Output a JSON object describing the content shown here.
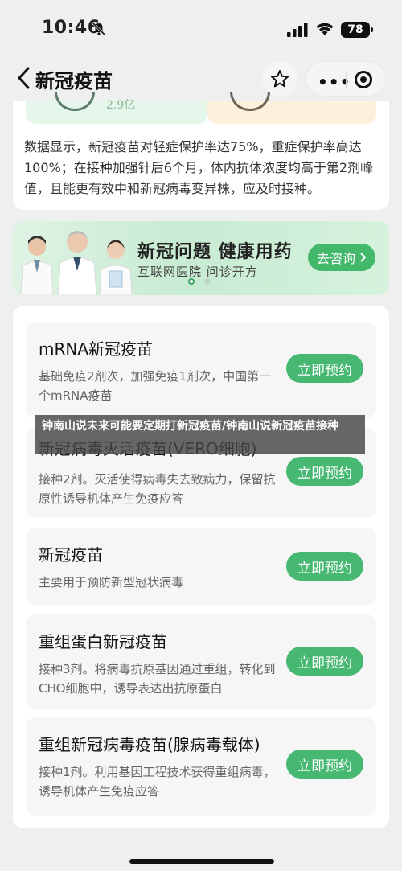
{
  "status": {
    "time": "10:46",
    "battery": "78"
  },
  "nav": {
    "title": "新冠疫苗"
  },
  "top_card": {
    "left_value": "2.9亿",
    "text": "数据显示，新冠疫苗对轻症保护率达75%，重症保护率高达100%；在接种加强针后6个月，体内抗体浓度均高于第2剂峰值，且能更有效中和新冠病毒变异株，应及时接种。"
  },
  "banner": {
    "title": "新冠问题  健康用药",
    "subtitle": "互联网医院  问诊开方",
    "button": "去咨询"
  },
  "overlay_caption": "钟南山说未来可能要定期打新冠疫苗/钟南山说新冠疫苗接种",
  "vaccines": [
    {
      "title": "mRNA新冠疫苗",
      "desc": "基础免疫2剂次，加强免疫1剂次，中国第一个mRNA疫苗",
      "button": "立即预约"
    },
    {
      "title": "新冠病毒灭活疫苗(VERO细胞)",
      "desc": "接种2剂。灭活使得病毒失去致病力，保留抗原性诱导机体产生免疫应答",
      "button": "立即预约"
    },
    {
      "title": "新冠疫苗",
      "desc": "主要用于预防新型冠状病毒",
      "button": "立即预约"
    },
    {
      "title": "重组蛋白新冠疫苗",
      "desc": "接种3剂。将病毒抗原基因通过重组，转化到CHO细胞中，诱导表达出抗原蛋白",
      "button": "立即预约"
    },
    {
      "title": "重组新冠病毒疫苗(腺病毒载体)",
      "desc": "接种1剂。利用基因工程技术获得重组病毒，诱导机体产生免疫应答",
      "button": "立即预约"
    }
  ]
}
